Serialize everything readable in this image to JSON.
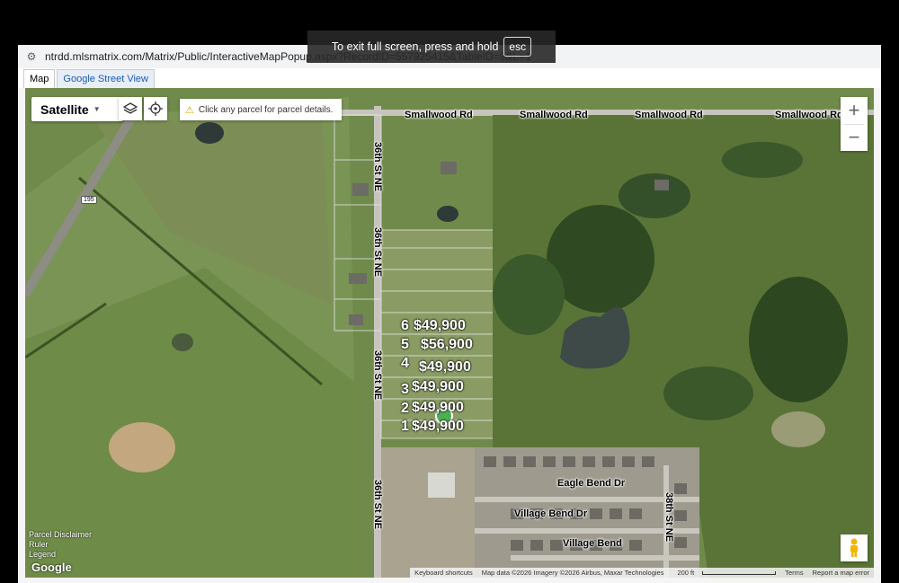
{
  "browser": {
    "url": "ntrdd.mlsmatrix.com/Matrix/Public/InteractiveMapPopup.aspx?RecordID=557925415&TableID=9&L=1",
    "tabs": [
      {
        "label": "Map",
        "active": true
      },
      {
        "label": "Google Street View",
        "active": false
      }
    ]
  },
  "fullscreen_banner": {
    "text": "To exit full screen, press and hold",
    "key": "esc"
  },
  "map_controls": {
    "map_type": "Satellite",
    "layers_icon": "layers-icon",
    "locate_icon": "locate-icon",
    "notice": "Click any parcel for parcel details.",
    "zoom_in": "+",
    "zoom_out": "−"
  },
  "roads": {
    "north": [
      "Smallwood Rd",
      "Smallwood Rd",
      "Smallwood Rd",
      "Smallwood Rd"
    ],
    "street_36": [
      "36th St NE",
      "36th St NE",
      "36th St NE",
      "36th St NE"
    ],
    "street_38": "38th St NE",
    "eagle_bend": "Eagle Bend Dr",
    "village_bend_dr": "Village Bend Dr",
    "village_bend": "Village Bend",
    "highway_shield": "195"
  },
  "lots": [
    {
      "number": "6",
      "price": "$49,900"
    },
    {
      "number": "5",
      "price": "$56,900"
    },
    {
      "number": "4",
      "price": "$49,900"
    },
    {
      "number": "3",
      "price": "$49,900"
    },
    {
      "number": "2",
      "price": "$49,900"
    },
    {
      "number": "1",
      "price": "$49,900"
    }
  ],
  "footer": {
    "left_links": [
      "Parcel Disclaimer",
      "Ruler",
      "Legend"
    ],
    "google": "Google",
    "keyboard": "Keyboard shortcuts",
    "map_data": "Map data ©2026 Imagery ©2026 Airbus, Maxar Technologies",
    "scale": "200 ft",
    "terms": "Terms",
    "report": "Report a map error"
  },
  "colors": {
    "lot_text": "#ffffff",
    "marker": "#4caf50",
    "pasture": "#6f8a4a"
  }
}
